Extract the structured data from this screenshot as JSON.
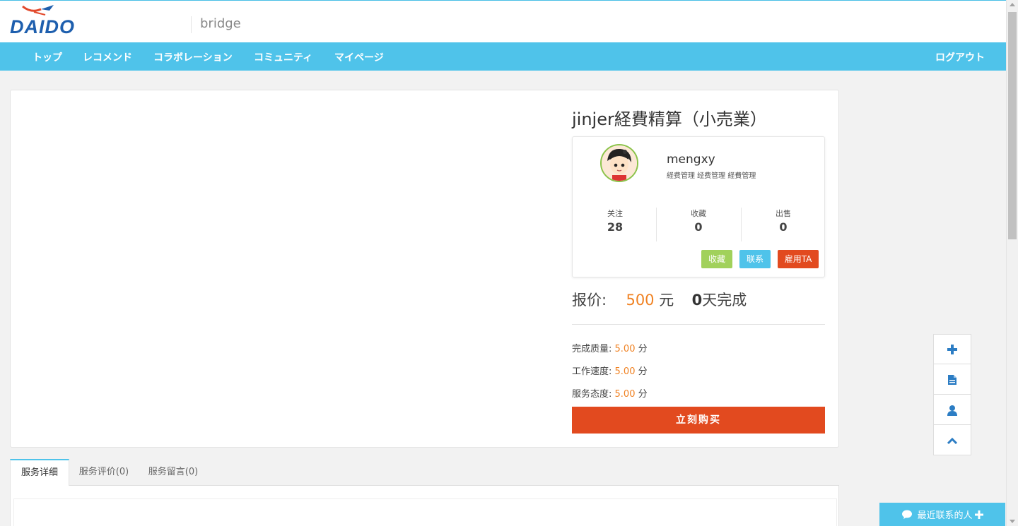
{
  "header": {
    "logo_text": "DAIDO",
    "site_title": "bridge"
  },
  "nav": {
    "items": [
      "トップ",
      "レコメンド",
      "コラボレーション",
      "コミュニティ",
      "マイページ"
    ],
    "logout": "ログアウト"
  },
  "service": {
    "title": "jinjer経費精算（小売業）",
    "seller": {
      "name": "mengxy",
      "tags": "経费管理 经费管理 経費管理",
      "stats": [
        {
          "label": "关注",
          "value": "28"
        },
        {
          "label": "收藏",
          "value": "0"
        },
        {
          "label": "出售",
          "value": "0"
        }
      ],
      "buttons": {
        "favorite": "收藏",
        "contact": "联系",
        "hire": "雇用TA"
      }
    },
    "price": {
      "label": "报价:",
      "amount": "500",
      "unit": "元",
      "days": "0",
      "days_suffix": "天完成"
    },
    "ratings": [
      {
        "label": "完成质量:",
        "score": "5.00",
        "unit": "分"
      },
      {
        "label": "工作速度:",
        "score": "5.00",
        "unit": "分"
      },
      {
        "label": "服务态度:",
        "score": "5.00",
        "unit": "分"
      }
    ],
    "buy_label": "立刻购买"
  },
  "tabs": [
    "服务详细",
    "服务评价(0)",
    "服务留言(0)"
  ],
  "contact_bar": {
    "label": "最近联系的人"
  },
  "colors": {
    "accent": "#4fc3ea",
    "orange": "#f08223",
    "buy": "#e24a1f",
    "green": "#a1d15b"
  }
}
